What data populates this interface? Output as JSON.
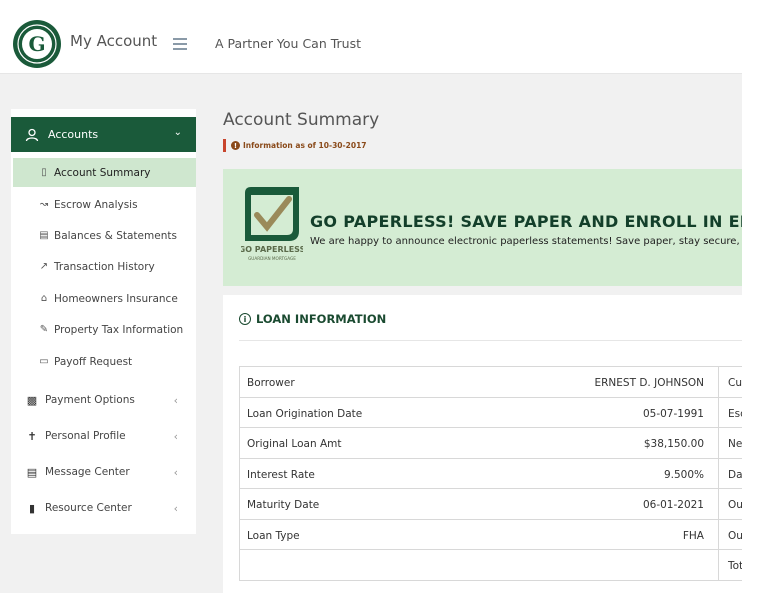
{
  "header": {
    "app_title": "My Account",
    "tagline": "A Partner You Can Trust",
    "logo_letter": "G"
  },
  "sidebar": {
    "accounts_label": "Accounts",
    "sub_items": [
      {
        "label": "Account Summary",
        "icon": "document-icon"
      },
      {
        "label": "Escrow Analysis",
        "icon": "chart-line-icon"
      },
      {
        "label": "Balances & Statements",
        "icon": "book-icon"
      },
      {
        "label": "Transaction History",
        "icon": "external-link-icon"
      },
      {
        "label": "Homeowners Insurance",
        "icon": "home-icon"
      },
      {
        "label": "Property Tax Information",
        "icon": "edit-icon"
      },
      {
        "label": "Payoff Request",
        "icon": "credit-card-icon"
      }
    ],
    "groups": [
      {
        "label": "Payment Options",
        "icon": "money-icon"
      },
      {
        "label": "Personal Profile",
        "icon": "person-icon"
      },
      {
        "label": "Message Center",
        "icon": "newspaper-icon"
      },
      {
        "label": "Resource Center",
        "icon": "book-solid-icon"
      }
    ]
  },
  "main": {
    "page_title": "Account Summary",
    "info_as_of": "Information as of 10-30-2017",
    "banner": {
      "title": "GO PAPERLESS! SAVE PAPER AND ENROLL IN ELECTRONIC STATEMENTS",
      "text": "We are happy to announce electronic paperless statements! Save paper, stay secure, and get your statements faster.",
      "logo_caption": "GO PAPERLESS",
      "logo_sub": "GUARDIAN MORTGAGE"
    },
    "loan_info": {
      "title": "LOAN INFORMATION",
      "rows": [
        {
          "label": "Borrower",
          "value": "ERNEST D. JOHNSON",
          "col3": "Cu"
        },
        {
          "label": "Loan Origination Date",
          "value": "05-07-1991",
          "col3": "Esc"
        },
        {
          "label": "Original Loan Amt",
          "value": "$38,150.00",
          "col3": "Ne"
        },
        {
          "label": "Interest Rate",
          "value": "9.500%",
          "col3": "Da"
        },
        {
          "label": "Maturity Date",
          "value": "06-01-2021",
          "col3": "Ou"
        },
        {
          "label": "Loan Type",
          "value": "FHA",
          "col3": "Ou"
        },
        {
          "label": "",
          "value": "",
          "col3": "Tot"
        }
      ]
    }
  },
  "colors": {
    "brand_green": "#1a5a3a",
    "active_item": "#cfe7cf",
    "banner_bg": "#d4ecd3",
    "info_bar": "#c8452d"
  }
}
